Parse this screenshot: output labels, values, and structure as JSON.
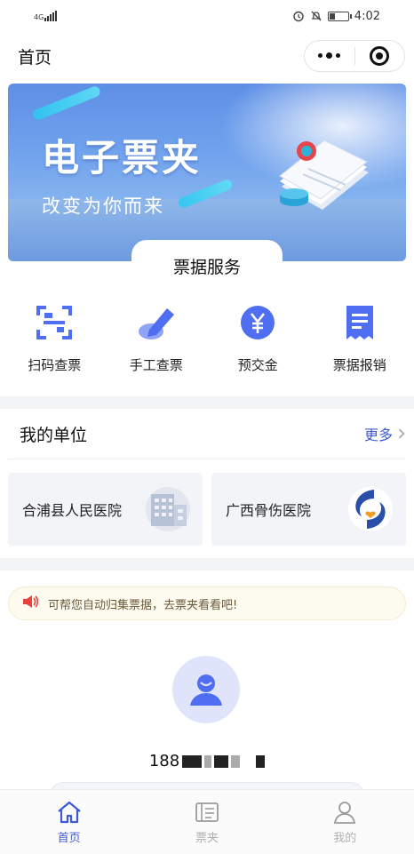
{
  "status_bar": {
    "network": "4G",
    "time": "4:02",
    "battery_level": 0.3
  },
  "nav": {
    "title": "首页",
    "icons": [
      "more-dots-icon",
      "target-close-icon"
    ]
  },
  "banner": {
    "title": "电子票夹",
    "subtitle": "改变为你而来"
  },
  "services": {
    "title": "票据服务",
    "items": [
      {
        "label": "扫码查票",
        "icon": "scan-code-icon"
      },
      {
        "label": "手工查票",
        "icon": "pencil-edit-icon"
      },
      {
        "label": "预交金",
        "icon": "yen-coin-icon"
      },
      {
        "label": "票据报销",
        "icon": "receipt-icon"
      }
    ]
  },
  "units": {
    "title": "我的单位",
    "more_label": "更多",
    "items": [
      {
        "name": "合浦县人民医院",
        "icon": "hospital-building-icon"
      },
      {
        "name": "广西骨伤医院",
        "icon": "hospital-logo-icon"
      }
    ]
  },
  "notice": {
    "text": "可帮您自动归集票据，去票夹看看吧!",
    "icon": "speaker-icon"
  },
  "profile": {
    "phone_prefix": "188"
  },
  "tab_bar": {
    "items": [
      {
        "label": "首页",
        "icon": "home-icon",
        "active": true
      },
      {
        "label": "票夹",
        "icon": "ticket-folder-icon",
        "active": false
      },
      {
        "label": "我的",
        "icon": "person-icon",
        "active": false
      }
    ]
  },
  "colors": {
    "accent": "#3d5bd6",
    "icon_blue": "#4f6ef2",
    "banner_blue": "#5d8fe6",
    "notice_red": "#e9423c"
  }
}
